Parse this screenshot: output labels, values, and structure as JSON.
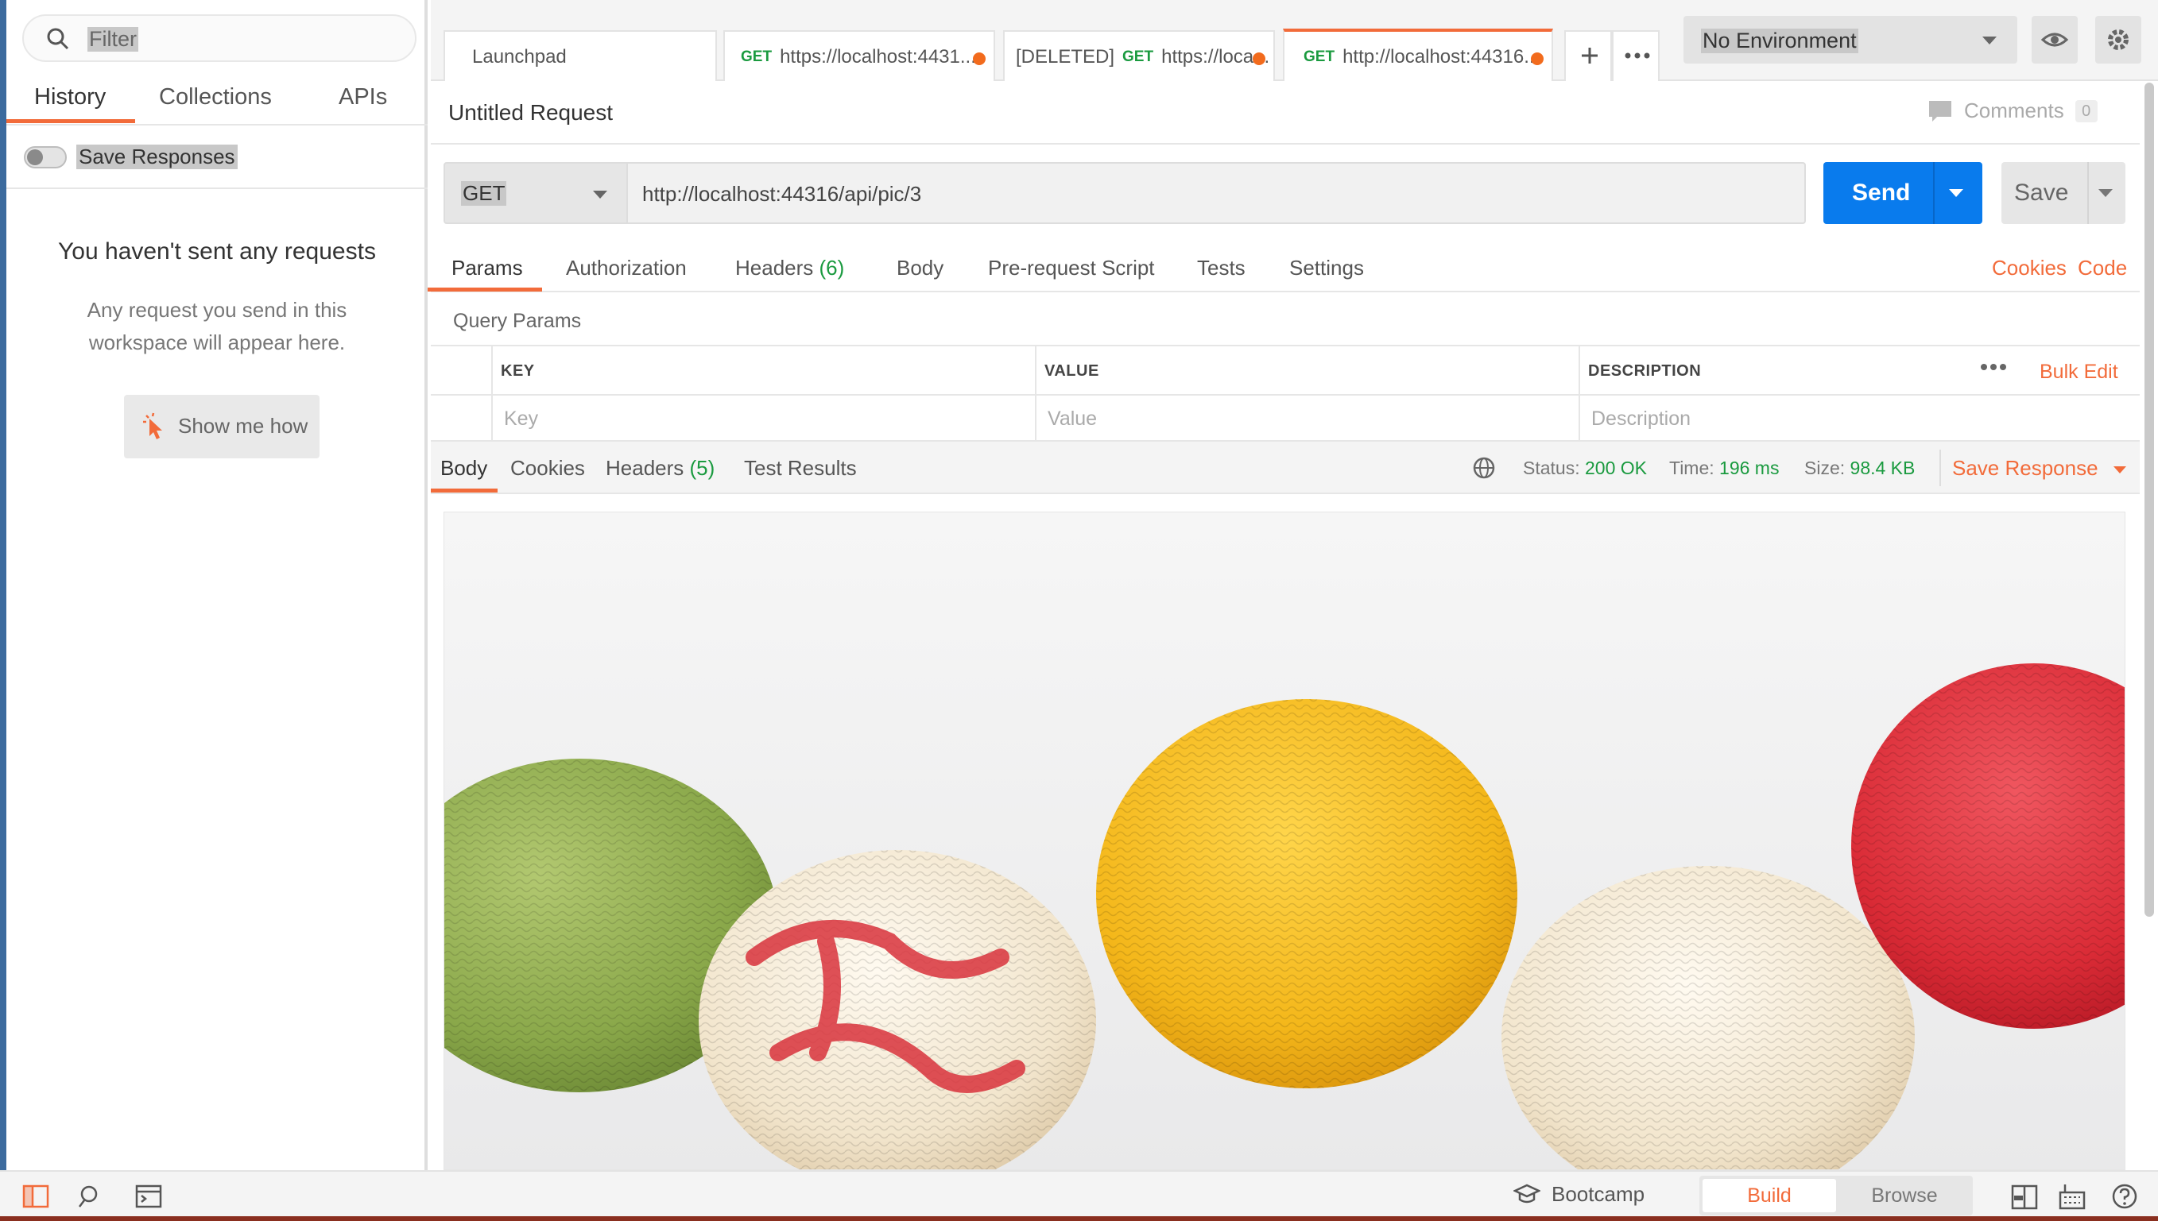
{
  "sidebar": {
    "filter_placeholder": "Filter",
    "tabs": [
      {
        "label": "History"
      },
      {
        "label": "Collections"
      },
      {
        "label": "APIs"
      }
    ],
    "save_responses_label": "Save Responses",
    "empty_title": "You haven't sent any requests",
    "empty_desc": "Any request you send in this workspace will appear here.",
    "show_me_how_label": "Show me how"
  },
  "tabs": [
    {
      "label": "Launchpad"
    },
    {
      "method": "GET",
      "label": "https://localhost:4431..."
    },
    {
      "prefix": "[DELETED]",
      "method": "GET",
      "label": "https://loca..."
    },
    {
      "method": "GET",
      "label": "http://localhost:44316..."
    }
  ],
  "environment": {
    "label": "No Environment"
  },
  "request": {
    "title": "Untitled Request",
    "comments_label": "Comments",
    "comments_count": "0",
    "method": "GET",
    "url": "http://localhost:44316/api/pic/3",
    "send_label": "Send",
    "save_label": "Save"
  },
  "request_tabs": {
    "params": "Params",
    "authorization": "Authorization",
    "headers": "Headers",
    "headers_count": "(6)",
    "body": "Body",
    "pre_request": "Pre-request Script",
    "tests": "Tests",
    "settings": "Settings",
    "cookies": "Cookies",
    "code": "Code"
  },
  "query_params": {
    "title": "Query Params",
    "columns": [
      "KEY",
      "VALUE",
      "DESCRIPTION"
    ],
    "placeholders": [
      "Key",
      "Value",
      "Description"
    ],
    "bulk_edit": "Bulk Edit"
  },
  "response": {
    "tabs": {
      "body": "Body",
      "cookies": "Cookies",
      "headers": "Headers",
      "headers_count": "(5)",
      "test_results": "Test Results"
    },
    "status_label": "Status:",
    "status_value": "200 OK",
    "time_label": "Time:",
    "time_value": "196 ms",
    "size_label": "Size:",
    "size_value": "98.4 KB",
    "save_response": "Save Response"
  },
  "footer": {
    "bootcamp": "Bootcamp",
    "build": "Build",
    "browse": "Browse"
  },
  "colors": {
    "accent": "#f26b3a",
    "send_blue": "#097bed",
    "success_green": "#1a9a3f"
  }
}
